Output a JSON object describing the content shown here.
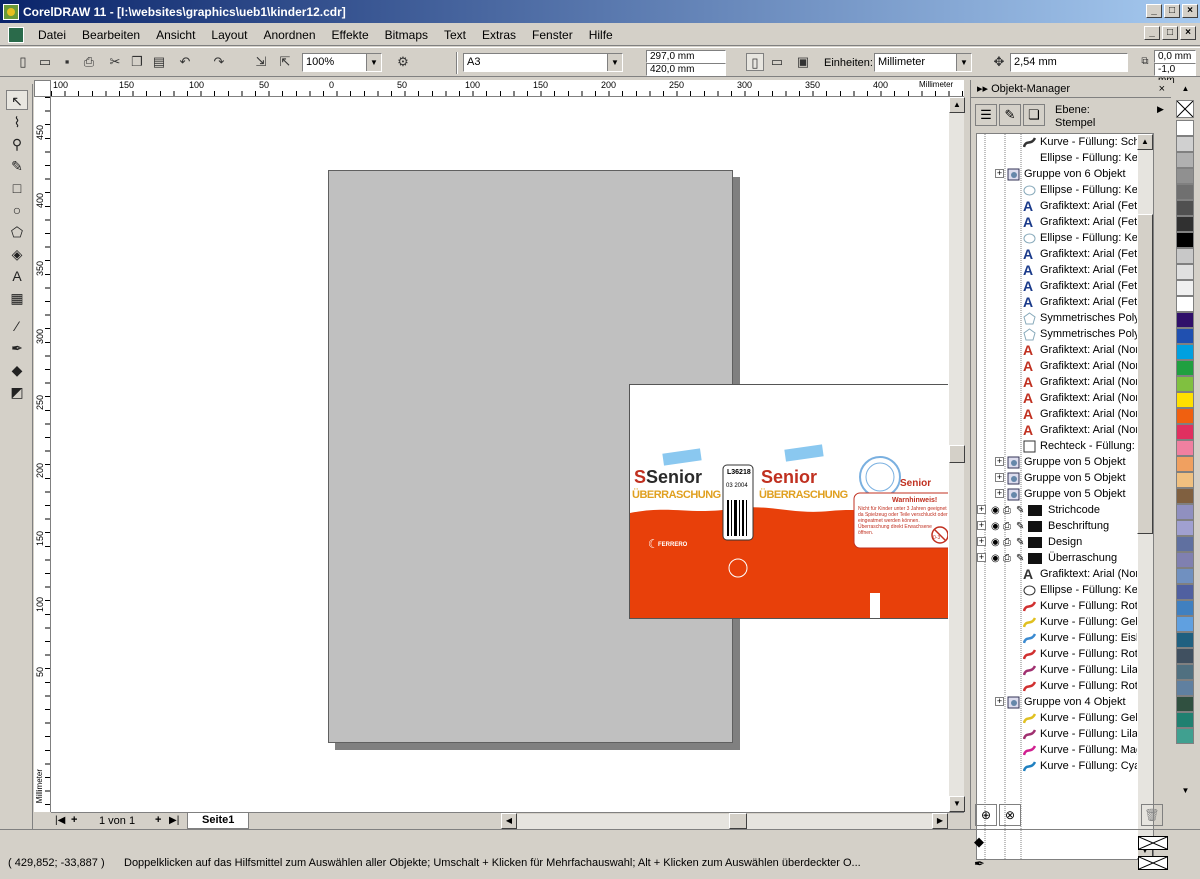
{
  "window": {
    "title": "CorelDRAW 11 - [I:\\websites\\graphics\\ueb1\\kinder12.cdr]"
  },
  "menu": [
    "Datei",
    "Bearbeiten",
    "Ansicht",
    "Layout",
    "Anordnen",
    "Effekte",
    "Bitmaps",
    "Text",
    "Extras",
    "Fenster",
    "Hilfe"
  ],
  "toolbar": {
    "zoom": "100%",
    "paper_size": "A3",
    "height_value": "297,0 mm",
    "width_value": "420,0 mm",
    "units_label": "Einheiten:",
    "units_value": "Millimeter",
    "nudge": "2,54 mm",
    "dup_x": "0,0 mm",
    "dup_y": "-1,0 mm"
  },
  "ruler": {
    "unit": "Millimeter",
    "top_ticks": [
      "100",
      "150",
      "100",
      "50",
      "0",
      "50",
      "100",
      "150",
      "200",
      "250",
      "300",
      "350",
      "400",
      "450",
      "500"
    ],
    "left_ticks": [
      "450",
      "400",
      "350",
      "300",
      "250",
      "200",
      "150",
      "100",
      "50"
    ],
    "left_unit": "Millimeter"
  },
  "page_nav": {
    "count": "1 von 1",
    "tab": "Seite1"
  },
  "docker": {
    "title": "Objekt-Manager",
    "layer_label": "Ebene:",
    "layer_value": "Stempel",
    "nodes": [
      {
        "t": "Kurve - Füllung: Schw",
        "i": "curve",
        "c": "#333",
        "l": 2
      },
      {
        "t": "Ellipse - Füllung: Kein",
        "i": "none",
        "c": "",
        "l": 2
      },
      {
        "t": "Gruppe von 6 Objekt",
        "i": "group",
        "c": "",
        "l": 1
      },
      {
        "t": "Ellipse - Füllung: Kein",
        "i": "ellipse",
        "c": "#8ab",
        "l": 2
      },
      {
        "t": "Grafiktext: Arial (Fet",
        "i": "text",
        "c": "#1a3a8a",
        "l": 2
      },
      {
        "t": "Grafiktext: Arial (Fet",
        "i": "text",
        "c": "#1a3a8a",
        "l": 2
      },
      {
        "t": "Ellipse - Füllung: Kein",
        "i": "ellipse",
        "c": "#8ab",
        "l": 2
      },
      {
        "t": "Grafiktext: Arial (Fet",
        "i": "text",
        "c": "#1a3a8a",
        "l": 2
      },
      {
        "t": "Grafiktext: Arial (Fet",
        "i": "text",
        "c": "#1a3a8a",
        "l": 2
      },
      {
        "t": "Grafiktext: Arial (Fet",
        "i": "text",
        "c": "#1a3a8a",
        "l": 2
      },
      {
        "t": "Grafiktext: Arial (Fet",
        "i": "text",
        "c": "#1a3a8a",
        "l": 2
      },
      {
        "t": "Symmetrisches Polyg",
        "i": "poly",
        "c": "#8ab",
        "l": 2
      },
      {
        "t": "Symmetrisches Polyg",
        "i": "poly",
        "c": "#8ab",
        "l": 2
      },
      {
        "t": "Grafiktext: Arial (Nor",
        "i": "text",
        "c": "#c03020",
        "l": 2
      },
      {
        "t": "Grafiktext: Arial (Nor",
        "i": "text",
        "c": "#c03020",
        "l": 2
      },
      {
        "t": "Grafiktext: Arial (Nor",
        "i": "text",
        "c": "#c03020",
        "l": 2
      },
      {
        "t": "Grafiktext: Arial (Nor",
        "i": "text",
        "c": "#c03020",
        "l": 2
      },
      {
        "t": "Grafiktext: Arial (Nor",
        "i": "text",
        "c": "#c03020",
        "l": 2
      },
      {
        "t": "Grafiktext: Arial (Nor",
        "i": "text",
        "c": "#c03020",
        "l": 2
      },
      {
        "t": "Rechteck - Füllung: V",
        "i": "rect",
        "c": "#fff",
        "l": 2
      },
      {
        "t": "Gruppe von 5 Objekt",
        "i": "group",
        "c": "",
        "l": 1
      },
      {
        "t": "Gruppe von 5 Objekt",
        "i": "group",
        "c": "",
        "l": 1
      },
      {
        "t": "Gruppe von 5 Objekt",
        "i": "group",
        "c": "",
        "l": 1
      },
      {
        "t": "Strichcode",
        "i": "layer",
        "c": "",
        "l": 0
      },
      {
        "t": "Beschriftung",
        "i": "layer",
        "c": "",
        "l": 0
      },
      {
        "t": "Design",
        "i": "layer",
        "c": "",
        "l": 0
      },
      {
        "t": "Überraschung",
        "i": "layer",
        "c": "",
        "l": 0
      },
      {
        "t": "Grafiktext: Arial (Nor",
        "i": "text",
        "c": "#333",
        "l": 2
      },
      {
        "t": "Ellipse - Füllung: Kein",
        "i": "ellipse",
        "c": "#333",
        "l": 2
      },
      {
        "t": "Kurve - Füllung: Rot,",
        "i": "curve",
        "c": "#d03030",
        "l": 2
      },
      {
        "t": "Kurve - Füllung: Gelb",
        "i": "curve",
        "c": "#e0c020",
        "l": 2
      },
      {
        "t": "Kurve - Füllung: Eisbl",
        "i": "curve",
        "c": "#3a8ad0",
        "l": 2
      },
      {
        "t": "Kurve - Füllung: Rot,",
        "i": "curve",
        "c": "#d03030",
        "l": 2
      },
      {
        "t": "Kurve - Füllung: Lila,",
        "i": "curve",
        "c": "#a03070",
        "l": 2
      },
      {
        "t": "Kurve - Füllung: Rot,",
        "i": "curve",
        "c": "#d03030",
        "l": 2
      },
      {
        "t": "Gruppe von 4 Objekt",
        "i": "group",
        "c": "",
        "l": 1
      },
      {
        "t": "Kurve - Füllung: Gelb",
        "i": "curve",
        "c": "#e0c020",
        "l": 2
      },
      {
        "t": "Kurve - Füllung: Lila,",
        "i": "curve",
        "c": "#a03070",
        "l": 2
      },
      {
        "t": "Kurve - Füllung: Mag",
        "i": "curve",
        "c": "#d02090",
        "l": 2
      },
      {
        "t": "Kurve - Füllung: Cyan",
        "i": "curve",
        "c": "#2080c0",
        "l": 2
      }
    ]
  },
  "palette": [
    "#ffffff",
    "#d0d0d0",
    "#b0b0b0",
    "#909090",
    "#707070",
    "#505050",
    "#303030",
    "#000000",
    "#c8c8c8",
    "#e0e0e0",
    "#f0f0f0",
    "#ffffff",
    "#30106a",
    "#2050b0",
    "#00a0e0",
    "#20a040",
    "#80c040",
    "#ffe000",
    "#f06010",
    "#e03060",
    "#f080a0",
    "#f0a060",
    "#f0c080",
    "#806040",
    "#9090c0",
    "#a0a0d0",
    "#6070a0",
    "#8080b0",
    "#7090c0",
    "#5060a0",
    "#4080c0",
    "#60a0e0",
    "#206080",
    "#405060",
    "#507080",
    "#6080a0",
    "#305040",
    "#208070",
    "#40a090"
  ],
  "status": {
    "coords": "( 429,852; -33,887 )",
    "hint": "Doppelklicken auf das Hilfsmittel zum Auswählen aller Objekte; Umschalt + Klicken für Mehrfachauswahl; Alt + Klicken zum Auswählen überdeckter O..."
  },
  "label": {
    "brand": "Senior",
    "sub": "ÜBERRASCHUNG",
    "code": "L36218",
    "date": "03 2004",
    "warn_title": "Warnhinweis!",
    "warn_text": "Nicht für Kinder unter 3 Jahren geeignet da Spielzeug oder Teile verschluckt oder eingeatmet werden können. Überraschung direkt Erwachsene öffnen.",
    "brand_small": "Senior",
    "ferrero": "FERRERO",
    "age": "0-3"
  }
}
